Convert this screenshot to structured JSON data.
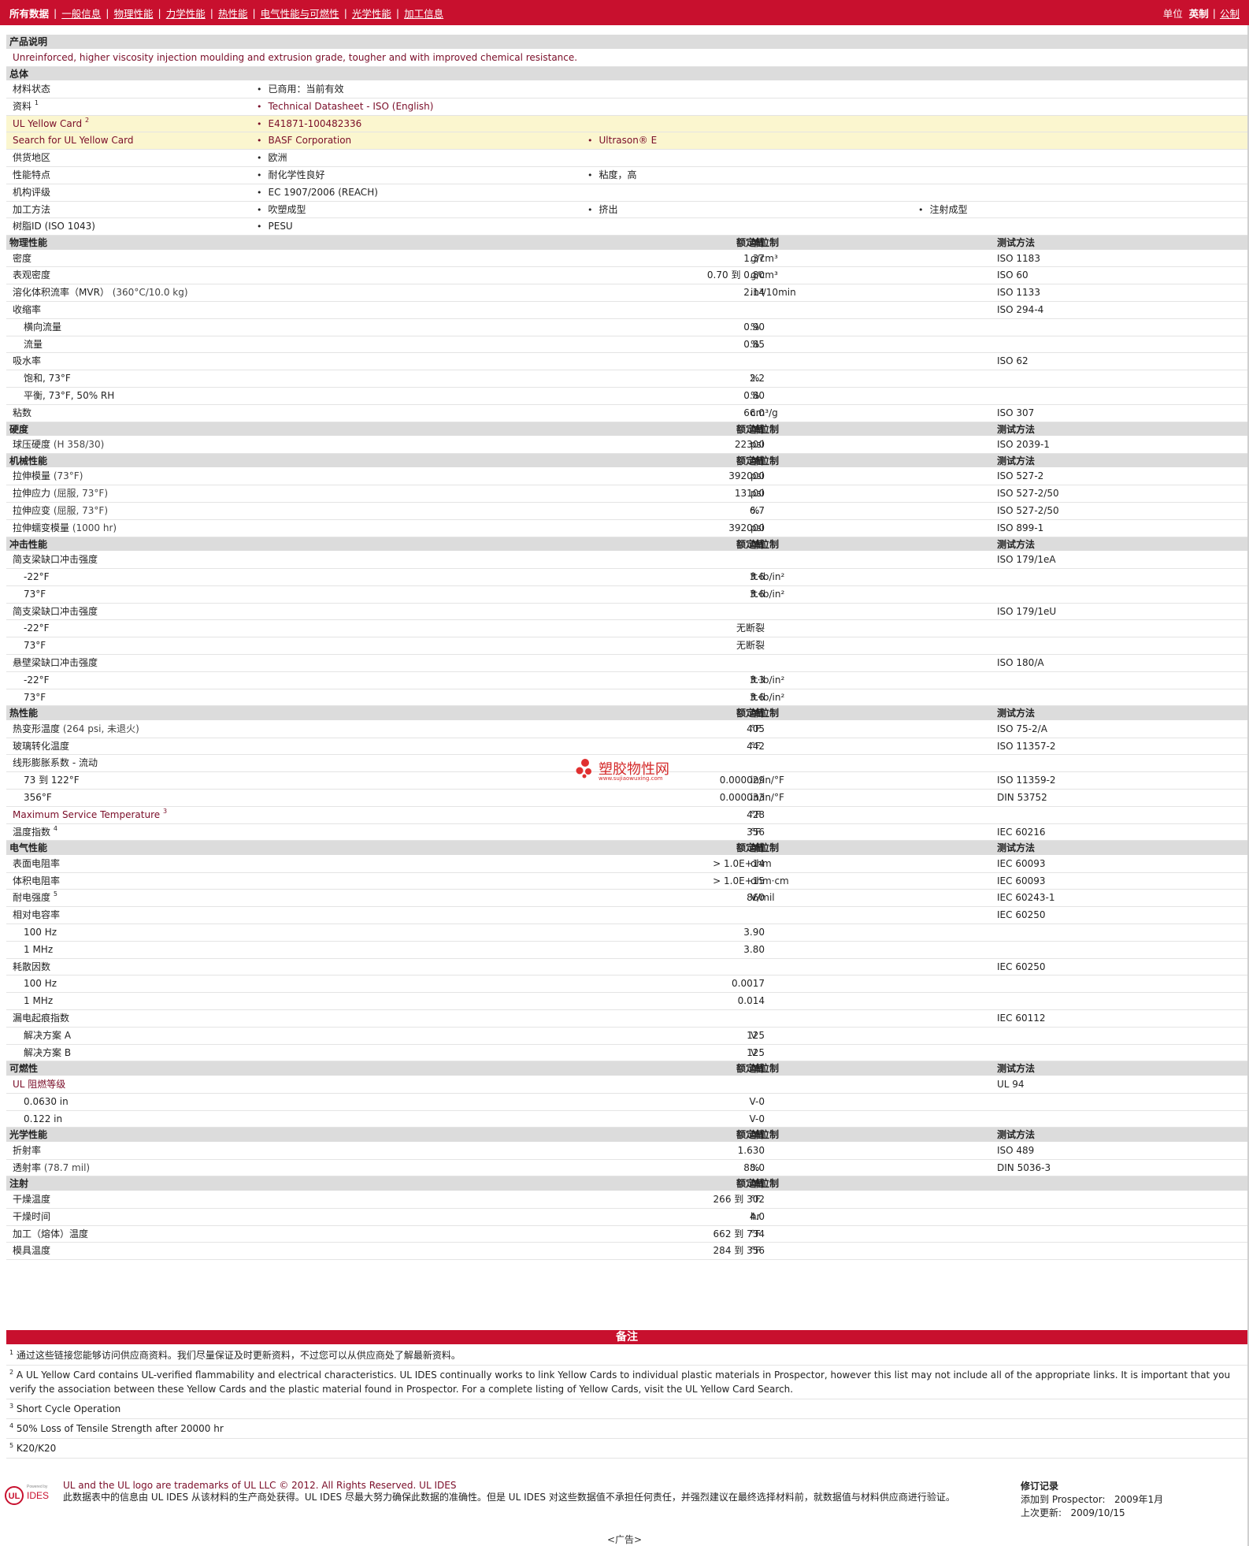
{
  "nav": {
    "items": [
      "所有数据",
      "一般信息",
      "物理性能",
      "力学性能",
      "热性能",
      "电气性能与可燃性",
      "光学性能",
      "加工信息"
    ],
    "unit_label": "单位",
    "unit_options": [
      "英制",
      "公制"
    ]
  },
  "product_description": {
    "header": "产品说明",
    "text": "Unreinforced, higher viscosity injection moulding and extrusion grade, tougher and with improved chemical resistance."
  },
  "general": {
    "header": "总体",
    "rows": [
      {
        "label": "材料状态",
        "values": [
          "已商用：当前有效"
        ]
      },
      {
        "label": "资料",
        "sup": "1",
        "values": [
          "Technical Datasheet - ISO (English)"
        ],
        "link": true
      },
      {
        "label": "UL Yellow Card",
        "sup": "2",
        "values": [
          "E41871-100482336"
        ],
        "link": true,
        "highlight": true
      },
      {
        "label": "Search for UL Yellow Card",
        "values": [
          "BASF Corporation",
          "Ultrason® E"
        ],
        "link": true,
        "highlight": true
      },
      {
        "label": "供货地区",
        "values": [
          "欧洲"
        ]
      },
      {
        "label": "性能特点",
        "values": [
          "耐化学性良好",
          "粘度，高"
        ]
      },
      {
        "label": "机构评级",
        "values": [
          "EC 1907/2006 (REACH)"
        ]
      },
      {
        "label": "加工方法",
        "values": [
          "吹塑成型",
          "挤出",
          "注射成型"
        ]
      },
      {
        "label": "树脂ID (ISO 1043)",
        "values": [
          "PESU"
        ]
      }
    ]
  },
  "col_headers": {
    "value": "额定值",
    "unit": "单位制",
    "method": "测试方法"
  },
  "sections": [
    {
      "header": "物理性能",
      "rows": [
        {
          "label": "密度",
          "value": "1.37",
          "unit": "g/cm³",
          "method": "ISO 1183"
        },
        {
          "label": "表观密度",
          "value": "0.70 到  0.80",
          "unit": "g/cm³",
          "method": "ISO 60"
        },
        {
          "label": "溶化体积流率（MVR）",
          "cond": "(360°C/10.0 kg)",
          "value": "2.14",
          "unit": "in³/10min",
          "method": "ISO 1133"
        },
        {
          "label": "收缩率",
          "value": "",
          "unit": "",
          "method": "ISO 294-4"
        },
        {
          "label": "横向流量",
          "sub": true,
          "value": "0.90",
          "unit": "%",
          "method": ""
        },
        {
          "label": "流量",
          "sub": true,
          "value": "0.85",
          "unit": "%",
          "method": ""
        },
        {
          "label": "吸水率",
          "value": "",
          "unit": "",
          "method": "ISO 62"
        },
        {
          "label": "饱和, 73°F",
          "sub": true,
          "value": "2.2",
          "unit": "%",
          "method": ""
        },
        {
          "label": "平衡, 73°F, 50% RH",
          "sub": true,
          "value": "0.80",
          "unit": "%",
          "method": ""
        },
        {
          "label": "粘数",
          "value": "66.0",
          "unit": "cm³/g",
          "method": "ISO 307"
        }
      ]
    },
    {
      "header": "硬度",
      "rows": [
        {
          "label": "球压硬度",
          "cond": "(H 358/30)",
          "value": "22300",
          "unit": "psi",
          "method": "ISO 2039-1"
        }
      ]
    },
    {
      "header": "机械性能",
      "rows": [
        {
          "label": "拉伸模量",
          "cond": "(73°F)",
          "value": "392000",
          "unit": "psi",
          "method": "ISO 527-2"
        },
        {
          "label": "拉伸应力",
          "cond": "(屈服, 73°F)",
          "value": "13100",
          "unit": "psi",
          "method": "ISO 527-2/50"
        },
        {
          "label": "拉伸应变",
          "cond": "(屈服, 73°F)",
          "value": "6.7",
          "unit": "%",
          "method": "ISO 527-2/50"
        },
        {
          "label": "拉伸蠕变模量",
          "cond": "(1000 hr)",
          "value": "392000",
          "unit": "psi",
          "method": "ISO 899-1"
        }
      ]
    },
    {
      "header": "冲击性能",
      "rows": [
        {
          "label": "简支梁缺口冲击强度",
          "value": "",
          "unit": "",
          "method": "ISO 179/1eA"
        },
        {
          "label": "-22°F",
          "sub": true,
          "value": "3.6",
          "unit": "ft·lb/in²",
          "method": ""
        },
        {
          "label": "73°F",
          "sub": true,
          "value": "3.6",
          "unit": "ft·lb/in²",
          "method": ""
        },
        {
          "label": "简支梁缺口冲击强度",
          "value": "",
          "unit": "",
          "method": "ISO 179/1eU"
        },
        {
          "label": "-22°F",
          "sub": true,
          "value": "无断裂",
          "unit": "",
          "method": ""
        },
        {
          "label": "73°F",
          "sub": true,
          "value": "无断裂",
          "unit": "",
          "method": ""
        },
        {
          "label": "悬壁梁缺口冲击强度",
          "value": "",
          "unit": "",
          "method": "ISO 180/A"
        },
        {
          "label": "-22°F",
          "sub": true,
          "value": "3.3",
          "unit": "ft·lb/in²",
          "method": ""
        },
        {
          "label": "73°F",
          "sub": true,
          "value": "3.6",
          "unit": "ft·lb/in²",
          "method": ""
        }
      ]
    },
    {
      "header": "热性能",
      "rows": [
        {
          "label": "热变形温度",
          "cond": "(264 psi, 未退火)",
          "value": "405",
          "unit": "°F",
          "method": "ISO 75-2/A"
        },
        {
          "label": "玻璃转化温度",
          "value": "442",
          "unit": "°F",
          "method": "ISO 11357-2"
        },
        {
          "label": "线形膨胀系数 - 流动",
          "value": "",
          "unit": "",
          "method": ""
        },
        {
          "label": "73 到 122°F",
          "sub": true,
          "value": "0.000029",
          "unit": "in/in/°F",
          "method": "ISO 11359-2"
        },
        {
          "label": "356°F",
          "sub": true,
          "value": "0.000033",
          "unit": "in/in/°F",
          "method": "DIN 53752"
        },
        {
          "label": "Maximum Service Temperature",
          "sup": "3",
          "link": true,
          "value": "428",
          "unit": "°F",
          "method": ""
        },
        {
          "label": "温度指数",
          "sup": "4",
          "value": "356",
          "unit": "°F",
          "method": "IEC 60216"
        }
      ]
    },
    {
      "header": "电气性能",
      "rows": [
        {
          "label": "表面电阻率",
          "value": "> 1.0E+14",
          "unit": "ohm",
          "method": "IEC 60093"
        },
        {
          "label": "体积电阻率",
          "value": "> 1.0E+15",
          "unit": "ohm·cm",
          "method": "IEC 60093"
        },
        {
          "label": "耐电强度",
          "sup": "5",
          "value": "860",
          "unit": "V/mil",
          "method": "IEC 60243-1"
        },
        {
          "label": "相对电容率",
          "value": "",
          "unit": "",
          "method": "IEC 60250"
        },
        {
          "label": "100 Hz",
          "sub": true,
          "value": "3.90",
          "unit": "",
          "method": ""
        },
        {
          "label": "1 MHz",
          "sub": true,
          "value": "3.80",
          "unit": "",
          "method": ""
        },
        {
          "label": "耗散因数",
          "value": "",
          "unit": "",
          "method": "IEC 60250"
        },
        {
          "label": "100 Hz",
          "sub": true,
          "value": "0.0017",
          "unit": "",
          "method": ""
        },
        {
          "label": "1 MHz",
          "sub": true,
          "value": "0.014",
          "unit": "",
          "method": ""
        },
        {
          "label": "漏电起痕指数",
          "value": "",
          "unit": "",
          "method": "IEC 60112"
        },
        {
          "label": "解决方案 A",
          "sub": true,
          "value": "125",
          "unit": "V",
          "method": ""
        },
        {
          "label": "解决方案 B",
          "sub": true,
          "value": "125",
          "unit": "V",
          "method": ""
        }
      ]
    },
    {
      "header": "可燃性",
      "rows": [
        {
          "label": "UL 阻燃等级",
          "link": true,
          "value": "",
          "unit": "",
          "method": "UL 94"
        },
        {
          "label": "0.0630 in",
          "sub": true,
          "value": "V-0",
          "unit": "",
          "method": ""
        },
        {
          "label": "0.122 in",
          "sub": true,
          "value": "V-0",
          "unit": "",
          "method": ""
        }
      ]
    },
    {
      "header": "光学性能",
      "rows": [
        {
          "label": "折射率",
          "value": "1.630",
          "unit": "",
          "method": "ISO 489"
        },
        {
          "label": "透射率",
          "cond": "(78.7 mil)",
          "value": "88.0",
          "unit": "%",
          "method": "DIN 5036-3"
        }
      ]
    },
    {
      "header": "注射",
      "nomethod": true,
      "rows": [
        {
          "label": "干燥温度",
          "value": "266 到  302",
          "unit": "°F",
          "method": ""
        },
        {
          "label": "干燥时间",
          "value": "4.0",
          "unit": "hr",
          "method": ""
        },
        {
          "label": "加工（熔体）温度",
          "value": "662 到  734",
          "unit": "°F",
          "method": ""
        },
        {
          "label": "模具温度",
          "value": "284 到  356",
          "unit": "°F",
          "method": ""
        }
      ]
    }
  ],
  "notes": {
    "header": "备注",
    "items": [
      {
        "n": "1",
        "text": "通过这些链接您能够访问供应商资料。我们尽量保证及时更新资料，不过您可以从供应商处了解最新资料。"
      },
      {
        "n": "2",
        "text": "A UL Yellow Card contains UL-verified flammability and electrical characteristics. UL IDES continually works to link Yellow Cards to individual plastic materials in Prospector, however this list may not include all of the appropriate links. It is important that you verify the association between these Yellow Cards and the plastic material found in Prospector. For a complete listing of Yellow Cards, visit the UL Yellow Card Search."
      },
      {
        "n": "3",
        "text": "Short Cycle Operation"
      },
      {
        "n": "4",
        "text": "50% Loss of Tensile Strength after 20000 hr"
      },
      {
        "n": "5",
        "text": "K20/K20"
      }
    ]
  },
  "footer": {
    "logo_ul": "UL",
    "logo_ides": "IDES",
    "logo_small": "Powered by",
    "line1": "UL and the UL logo are trademarks of UL LLC © 2012. All Rights Reserved. UL IDES",
    "line2": "此数据表中的信息由 UL IDES 从该材料的生产商处获得。UL IDES 尽最大努力确保此数据的准确性。但是 UL IDES 对这些数据值不承担任何责任，并强烈建议在最终选择材料前，就数据值与材料供应商进行验证。",
    "rev_title": "修订记录",
    "rev_added_label": "添加到 Prospector:",
    "rev_added": "2009年1月",
    "rev_updated_label": "上次更新:",
    "rev_updated": "2009/10/15"
  },
  "watermark": {
    "name": "塑胶物性网",
    "url": "www.sujiaowuxing.com"
  },
  "ad": "<广告>",
  "colors": {
    "brand_red": "#c8102e",
    "header_gray": "#dcdcdc",
    "highlight_yellow": "#fbf6cf",
    "link_maroon": "#7a0d28"
  }
}
